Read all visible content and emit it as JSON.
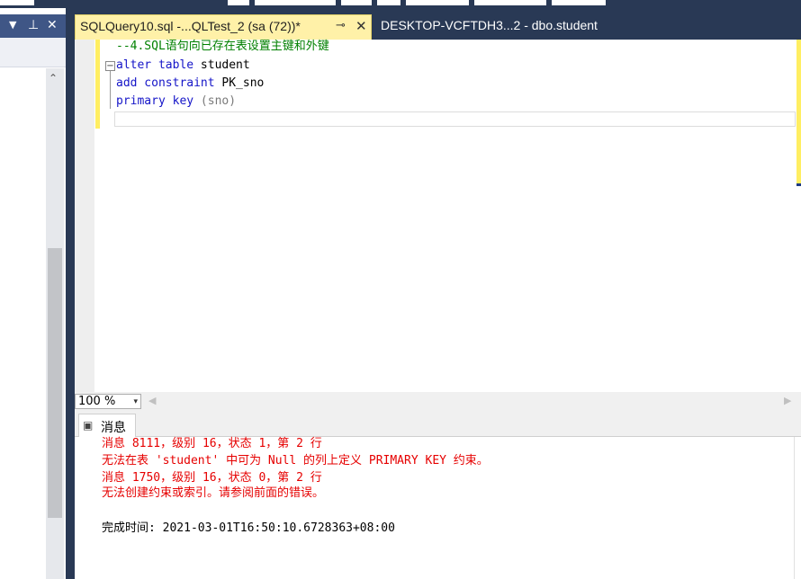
{
  "left_panel": {
    "dropdown_icon": "▼",
    "pin_icon": "⊥",
    "close_icon": "✕",
    "scroll_up_icon": "⌃"
  },
  "tabs": {
    "active": {
      "label": "SQLQuery10.sql -...QLTest_2 (sa (72))*",
      "pin_icon": "⊸",
      "close_icon": "✕"
    },
    "inactive": {
      "label": "DESKTOP-VCFTDH3...2 - dbo.student"
    }
  },
  "editor": {
    "comment": "--4.SQL语句向已存在表设置主键和外键",
    "line2_kw": "alter table",
    "line2_name": " student",
    "line3_kw": "add constraint",
    "line3_name": " PK_sno",
    "line4_kw": "primary key",
    "line4_rest": " (sno)",
    "collapse_icon": "−"
  },
  "zoom": {
    "value": "100 %",
    "arrow": "▾"
  },
  "results": {
    "tab_label": "消息",
    "tab_icon": "▣",
    "messages": [
      "消息 8111，级别 16，状态 1，第 2 行",
      "无法在表 'student' 中可为 Null 的列上定义 PRIMARY KEY 约束。",
      "消息 1750，级别 16，状态 0，第 2 行",
      "无法创建约束或索引。请参阅前面的错误。"
    ],
    "completion": "完成时间: 2021-03-01T16:50:10.6728363+08:00"
  }
}
